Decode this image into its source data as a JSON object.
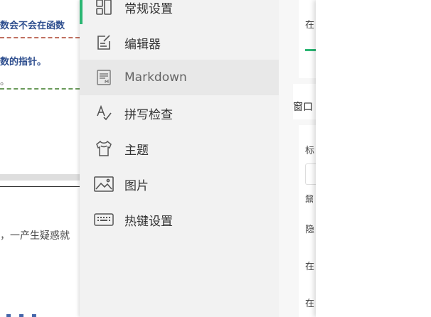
{
  "document": {
    "lines": [
      {
        "text": "数会不会在函数",
        "style": "blue"
      },
      {
        "text": "数的指针。",
        "style": "blue"
      },
      {
        "text": "。",
        "style": "plain"
      },
      {
        "text": "，一产生疑惑就",
        "style": "plain"
      }
    ]
  },
  "sidebar": {
    "items": [
      {
        "label": "常规设置",
        "icon": "layout-icon",
        "active": true
      },
      {
        "label": "编辑器",
        "icon": "edit-icon"
      },
      {
        "label": "Markdown",
        "icon": "markdown-icon",
        "hovered": true
      },
      {
        "label": "拼写检查",
        "icon": "spellcheck-icon"
      },
      {
        "label": "主题",
        "icon": "tshirt-icon"
      },
      {
        "label": "图片",
        "icon": "image-icon"
      },
      {
        "label": "热键设置",
        "icon": "keyboard-icon"
      }
    ],
    "accent_color": "#2bb673"
  },
  "settings_panel": {
    "row1": "在",
    "section_title": "窗口",
    "label_title": "标",
    "label_2": "鼐",
    "label_3": "隐",
    "label_4": "在",
    "label_5": "在"
  }
}
